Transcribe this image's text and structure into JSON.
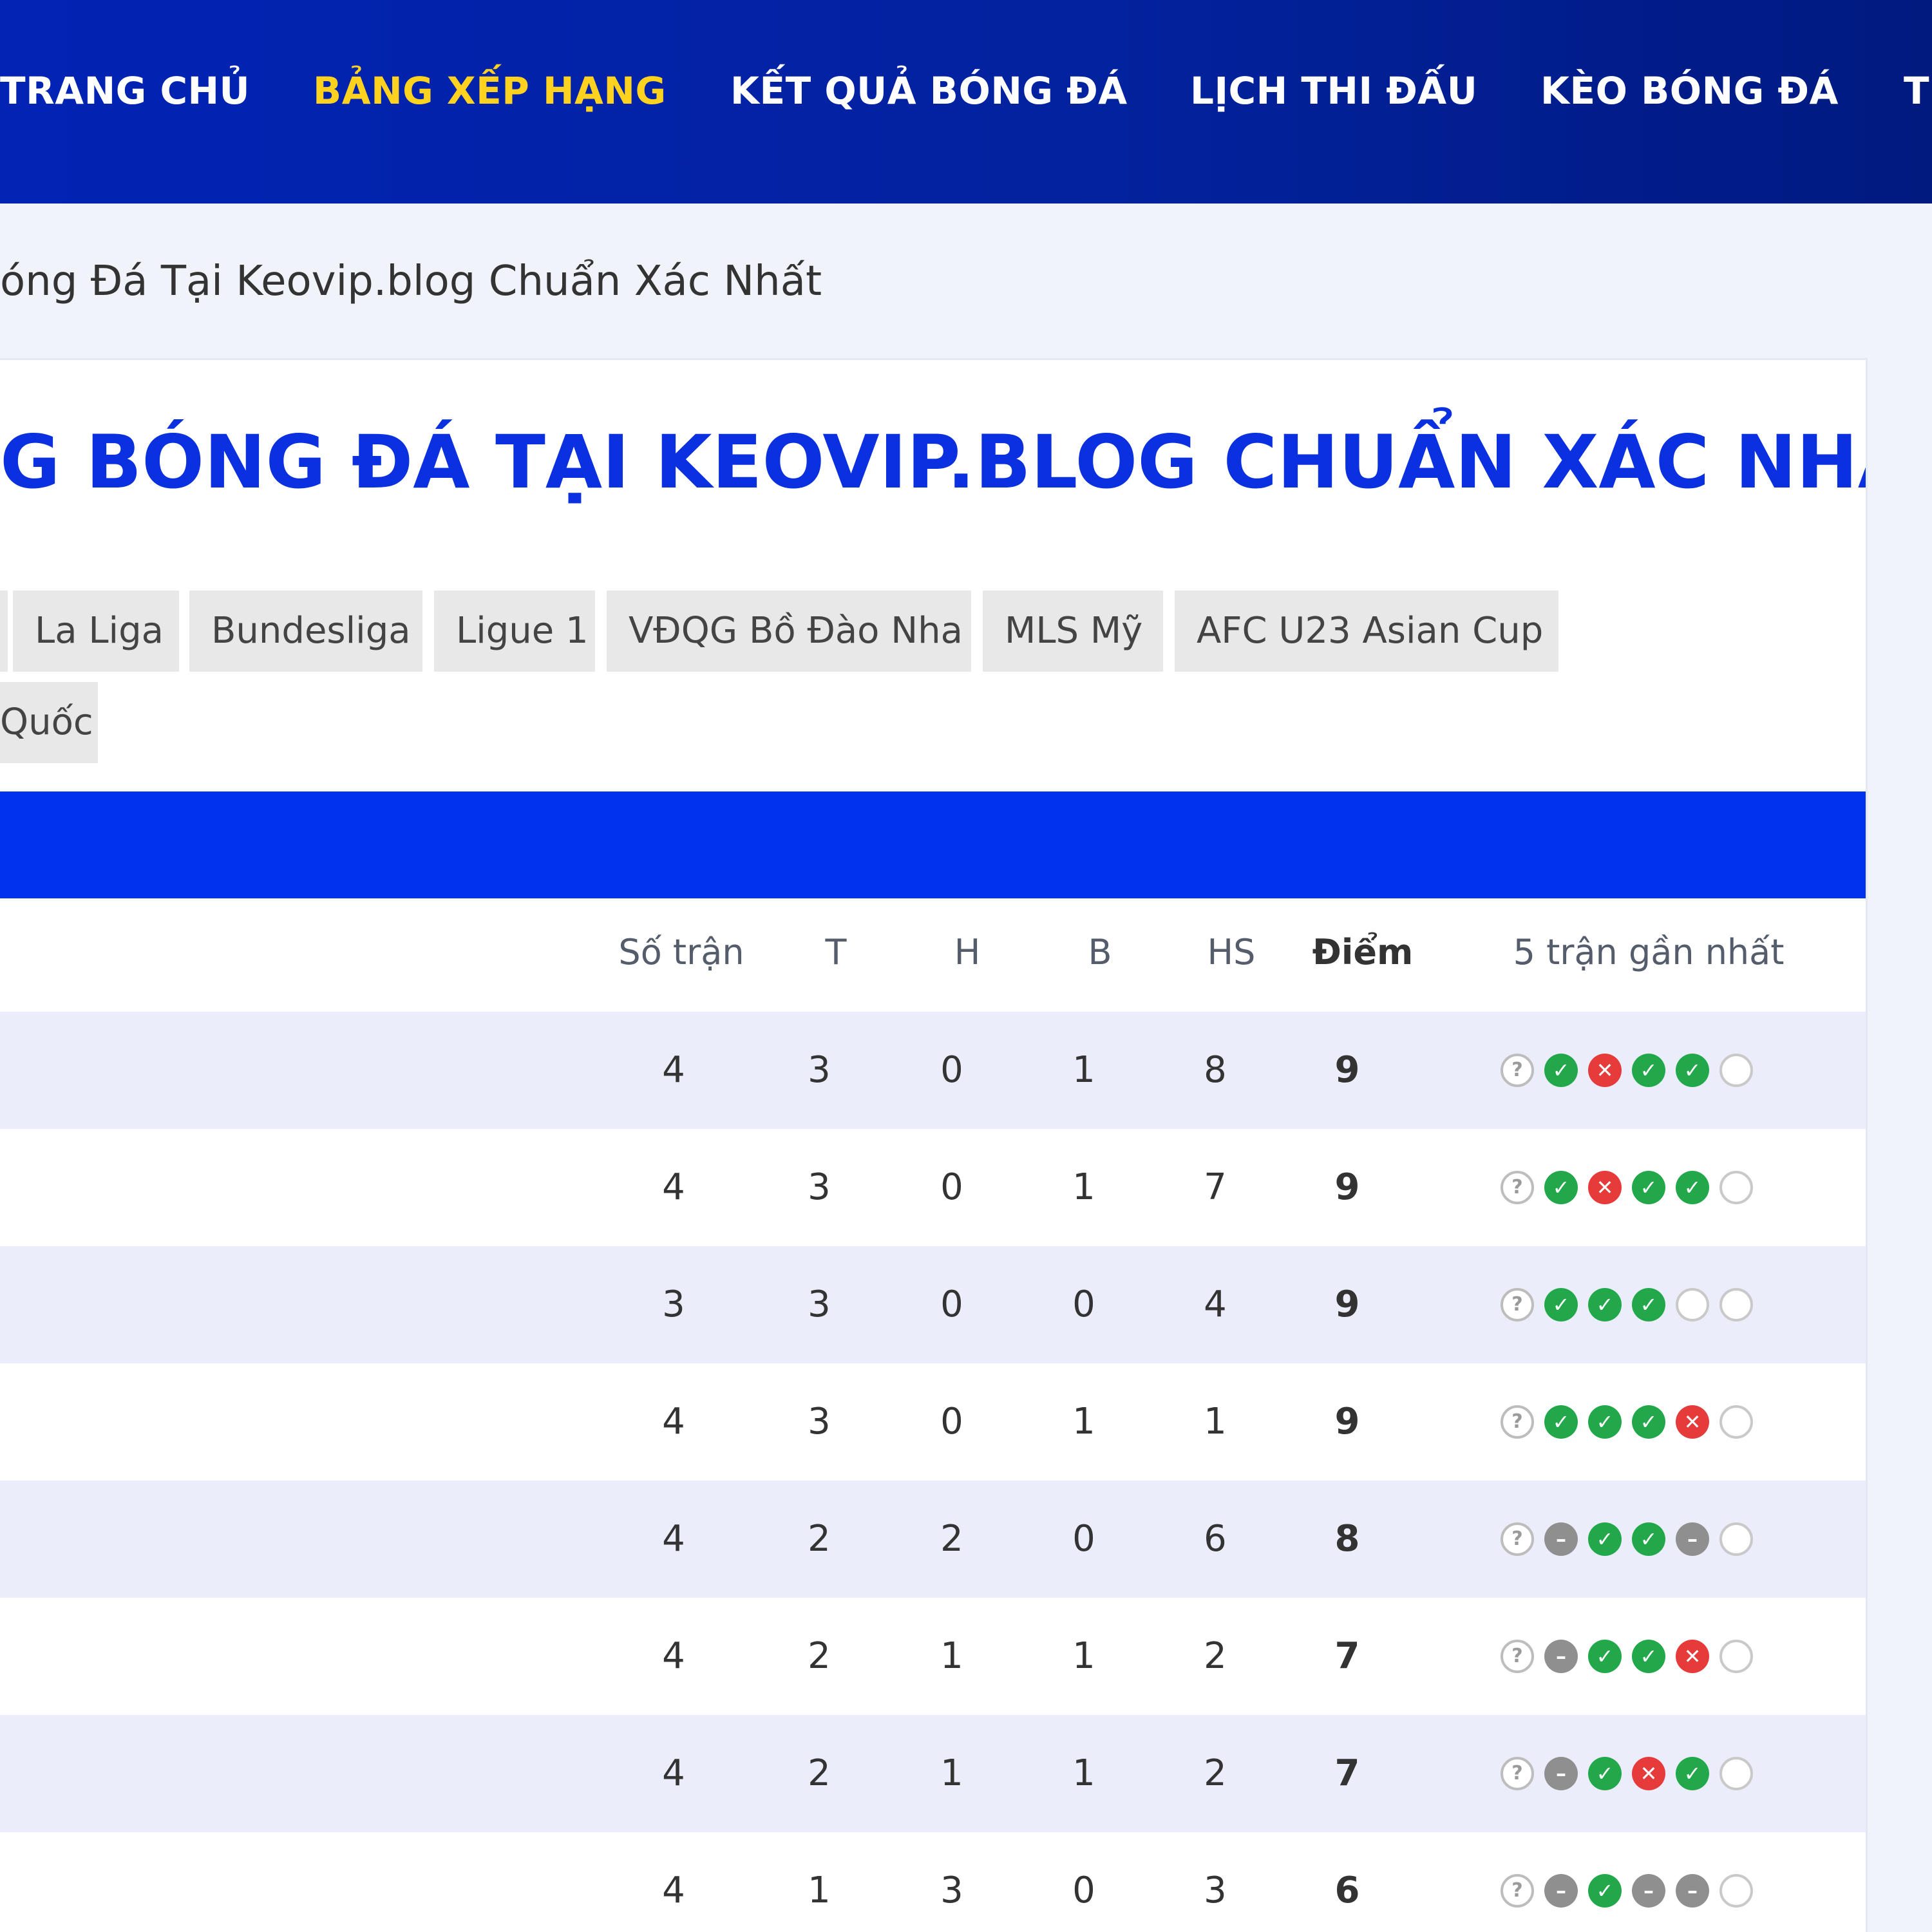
{
  "nav": {
    "items": [
      {
        "label": "TRANG CHỦ",
        "active": false
      },
      {
        "label": "BẢNG XẾP HẠNG",
        "active": true
      },
      {
        "label": "KẾT QUẢ BÓNG ĐÁ",
        "active": false
      },
      {
        "label": "LỊCH THI ĐẤU",
        "active": false
      },
      {
        "label": "KÈO BÓNG ĐÁ",
        "active": false
      },
      {
        "label": "T",
        "active": false
      }
    ]
  },
  "breadcrumb": "óng Đá Tại Keovip.blog Chuẩn Xác Nhất",
  "page_title": "G BÓNG ĐÁ TẠI KEOVIP.BLOG CHUẨN XÁC NHẤT",
  "league_tabs": [
    "La Liga",
    "Bundesliga",
    "Ligue 1",
    "VĐQG Bồ Đào Nha",
    "MLS Mỹ",
    "AFC U23 Asian Cup",
    "Quốc"
  ],
  "table": {
    "headers": {
      "played": "Số trận",
      "wins": "T",
      "draws": "H",
      "losses": "B",
      "goal_diff": "HS",
      "points": "Điểm",
      "form": "5 trận gần nhất"
    },
    "rows": [
      {
        "played": "4",
        "wins": "3",
        "draws": "0",
        "losses": "1",
        "goal_diff": "8",
        "points": "9",
        "form": [
          "unknown",
          "win",
          "loss",
          "win",
          "win",
          "empty"
        ]
      },
      {
        "played": "4",
        "wins": "3",
        "draws": "0",
        "losses": "1",
        "goal_diff": "7",
        "points": "9",
        "form": [
          "unknown",
          "win",
          "loss",
          "win",
          "win",
          "empty"
        ]
      },
      {
        "played": "3",
        "wins": "3",
        "draws": "0",
        "losses": "0",
        "goal_diff": "4",
        "points": "9",
        "form": [
          "unknown",
          "win",
          "win",
          "win",
          "empty",
          "empty"
        ]
      },
      {
        "played": "4",
        "wins": "3",
        "draws": "0",
        "losses": "1",
        "goal_diff": "1",
        "points": "9",
        "form": [
          "unknown",
          "win",
          "win",
          "win",
          "loss",
          "empty"
        ]
      },
      {
        "played": "4",
        "wins": "2",
        "draws": "2",
        "losses": "0",
        "goal_diff": "6",
        "points": "8",
        "form": [
          "unknown",
          "draw",
          "win",
          "win",
          "draw",
          "empty"
        ]
      },
      {
        "played": "4",
        "wins": "2",
        "draws": "1",
        "losses": "1",
        "goal_diff": "2",
        "points": "7",
        "form": [
          "unknown",
          "draw",
          "win",
          "win",
          "loss",
          "empty"
        ]
      },
      {
        "played": "4",
        "wins": "2",
        "draws": "1",
        "losses": "1",
        "goal_diff": "2",
        "points": "7",
        "form": [
          "unknown",
          "draw",
          "win",
          "loss",
          "win",
          "empty"
        ]
      },
      {
        "played": "4",
        "wins": "1",
        "draws": "3",
        "losses": "0",
        "goal_diff": "3",
        "points": "6",
        "form": [
          "unknown",
          "draw",
          "win",
          "draw",
          "draw",
          "empty"
        ]
      }
    ]
  },
  "colors": {
    "nav_bg": "#0223b4",
    "nav_active": "#ffd21f",
    "title": "#0a30e0",
    "banner": "#0033ee",
    "alt_row": "#ecedfb",
    "win": "#22a84a",
    "loss": "#e63b3b",
    "draw": "#8f8f8f"
  },
  "icons": {
    "win": "check-circle-icon",
    "loss": "x-circle-icon",
    "draw": "minus-circle-icon",
    "unknown": "question-circle-icon",
    "empty": "empty-circle-icon"
  }
}
